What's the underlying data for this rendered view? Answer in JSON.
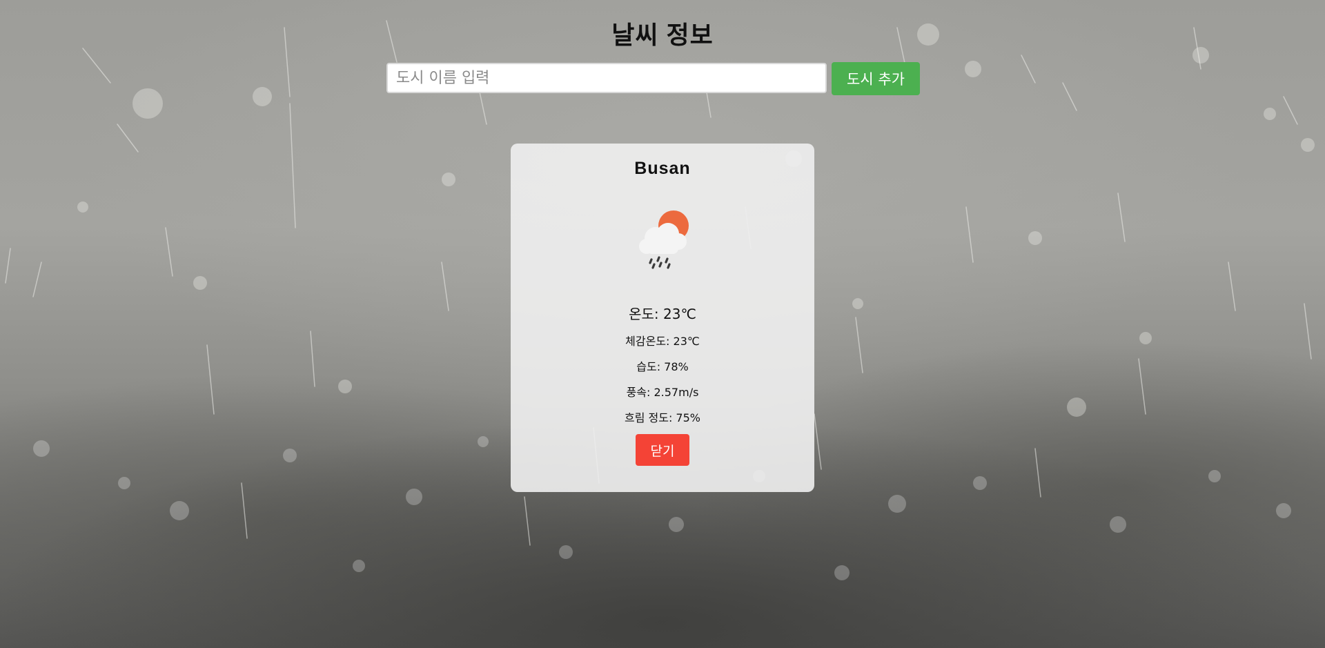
{
  "header": {
    "title": "날씨 정보"
  },
  "search": {
    "placeholder": "도시 이름 입력",
    "value": "",
    "add_button_label": "도시 추가"
  },
  "card": {
    "city": "Busan",
    "icon": "rain-cloud-sun-icon",
    "temperature": "온도: 23℃",
    "feels_like": "체감온도: 23℃",
    "humidity": "습도: 78%",
    "wind_speed": "풍속: 2.57m/s",
    "cloudiness": "흐림 정도: 75%",
    "close_button_label": "닫기"
  },
  "colors": {
    "add_button": "#4cb050",
    "close_button": "#f44336",
    "sun": "#ec6a3e"
  },
  "background": {
    "description_icon": "rain-background-image"
  }
}
